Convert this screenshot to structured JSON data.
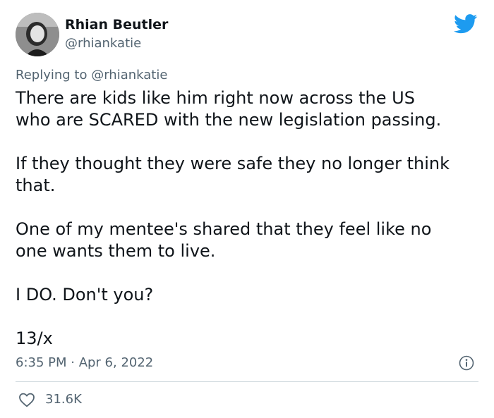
{
  "author": {
    "display_name": "Rhian Beutler",
    "handle": "@rhiankatie"
  },
  "reply": {
    "prefix": "Replying to ",
    "mention": "@rhiankatie"
  },
  "tweet": {
    "paragraphs": [
      "There are kids like him right now across the US\nwho are SCARED with the new legislation passing.",
      "If they thought they were safe they no longer think\nthat.",
      "One of my mentee's shared that they feel like no\none wants them to live.",
      "I DO. Don't you?",
      "13/x"
    ]
  },
  "timestamp": "6:35 PM · Apr 6, 2022",
  "likes": {
    "count": "31.6K"
  },
  "colors": {
    "brand_blue": "#1d9bf0",
    "text_primary": "#0f1419",
    "text_secondary": "#536471",
    "divider": "#cfd9de"
  },
  "icons": {
    "brand": "twitter-bird-icon",
    "info": "info-icon",
    "like": "heart-icon"
  }
}
